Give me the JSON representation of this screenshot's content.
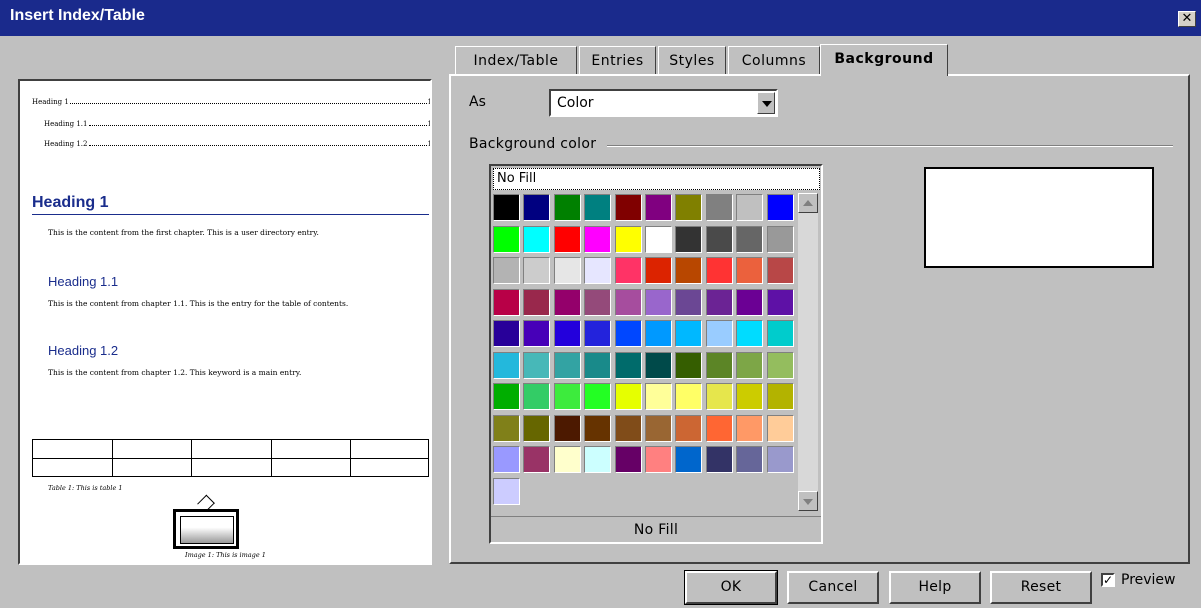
{
  "window": {
    "title": "Insert Index/Table",
    "close_glyph": "✕"
  },
  "preview": {
    "toc": [
      {
        "label": "Heading 1",
        "page": "1"
      },
      {
        "label": "Heading 1.1",
        "page": "1"
      },
      {
        "label": "Heading 1.2",
        "page": "1"
      }
    ],
    "heading1": "Heading 1",
    "text1": "This is the content from the first chapter. This is a user directory entry.",
    "heading11": "Heading 1.1",
    "text11": "This is the content from chapter 1.1. This is the entry for the table of contents.",
    "heading12": "Heading 1.2",
    "text12": "This is the content from chapter 1.2. This keyword is a main entry.",
    "table_caption": "Table 1: This is table 1",
    "image_caption": "Image 1: This is image 1"
  },
  "tabs": [
    "Index/Table",
    "Entries",
    "Styles",
    "Columns",
    "Background"
  ],
  "active_tab": "Background",
  "as": {
    "label": "As",
    "value": "Color"
  },
  "background_color_label": "Background color",
  "palette": {
    "no_fill_top": "No Fill",
    "no_fill_bottom": "No Fill",
    "colors": [
      "#000000",
      "#000080",
      "#008000",
      "#008080",
      "#800000",
      "#800080",
      "#808000",
      "#808080",
      "#c0c0c0",
      "#0000ff",
      "#00ff00",
      "#00ffff",
      "#ff0000",
      "#ff00ff",
      "#ffff00",
      "#ffffff",
      "#333333",
      "#4a4a4a",
      "#666666",
      "#999999",
      "#b3b3b3",
      "#cccccc",
      "#e6e6e6",
      "#e6e6ff",
      "#ff3366",
      "#dc2300",
      "#b84700",
      "#ff3333",
      "#eb613d",
      "#b84747",
      "#b80047",
      "#99284c",
      "#94006b",
      "#944a7a",
      "#a64d9e",
      "#9966cc",
      "#6b4794",
      "#6b2394",
      "#6b0094",
      "#5e11a6",
      "#280099",
      "#4700b8",
      "#2300dc",
      "#2323dc",
      "#0047ff",
      "#0099ff",
      "#00b8ff",
      "#99ccff",
      "#00dcff",
      "#00cccc",
      "#23b8dc",
      "#47b8b8",
      "#33a3a3",
      "#198a8a",
      "#006b6b",
      "#004a4a",
      "#355e00",
      "#5c8526",
      "#7da647",
      "#94bd5e",
      "#00ae00",
      "#33cc66",
      "#3deb3d",
      "#23ff23",
      "#e6ff00",
      "#ffff99",
      "#ffff66",
      "#e6e64c",
      "#cccc00",
      "#b3b300",
      "#808019",
      "#666600",
      "#4c1900",
      "#663300",
      "#804c19",
      "#996633",
      "#cc6633",
      "#ff6633",
      "#ff9966",
      "#ffcc99",
      "#9999ff",
      "#993366",
      "#ffffcc",
      "#ccffff",
      "#660066",
      "#ff8080",
      "#0066cc",
      "#333366",
      "#666699",
      "#9999cc",
      "#ccccff"
    ]
  },
  "buttons": {
    "ok": "OK",
    "cancel": "Cancel",
    "help": "Help",
    "reset": "Reset"
  },
  "preview_checkbox": {
    "label": "Preview",
    "checked": true
  }
}
